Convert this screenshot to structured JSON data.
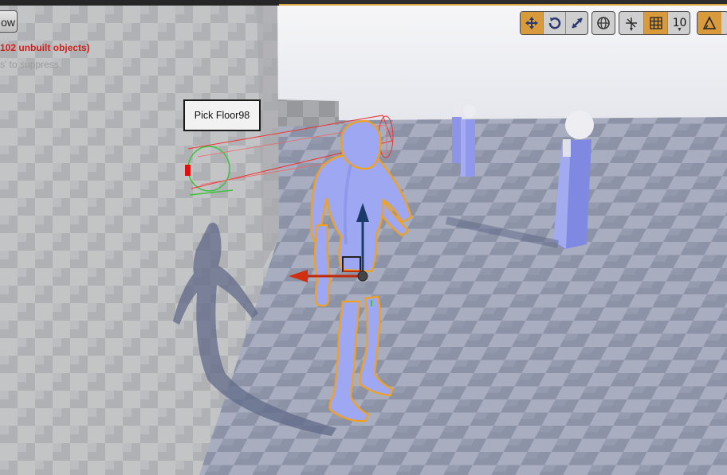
{
  "window": {
    "left_button_label": "ow"
  },
  "messages": {
    "unbuilt_warning": "102 unbuilt objects)",
    "suppress_hint": "s' to suppress"
  },
  "tooltip": {
    "label": "Pick Floor98"
  },
  "toolbar": {
    "translate_icon": "translate-move-icon",
    "rotate_icon": "rotate-icon",
    "scale_icon": "scale-icon",
    "world_icon": "world-space-globe-icon",
    "surface_snap_icon": "surface-snapping-icon",
    "grid_snap_icon": "grid-snap-icon",
    "grid_size": "10",
    "angle_snap_icon": "angle-snap-icon",
    "active_color": "#d89a3a"
  },
  "scene": {
    "selected_outline_color": "#f2a020",
    "mannequin_color": "#9ea8f2",
    "gizmo_x_color": "#d03010",
    "gizmo_z_color": "#1a3a6a"
  }
}
